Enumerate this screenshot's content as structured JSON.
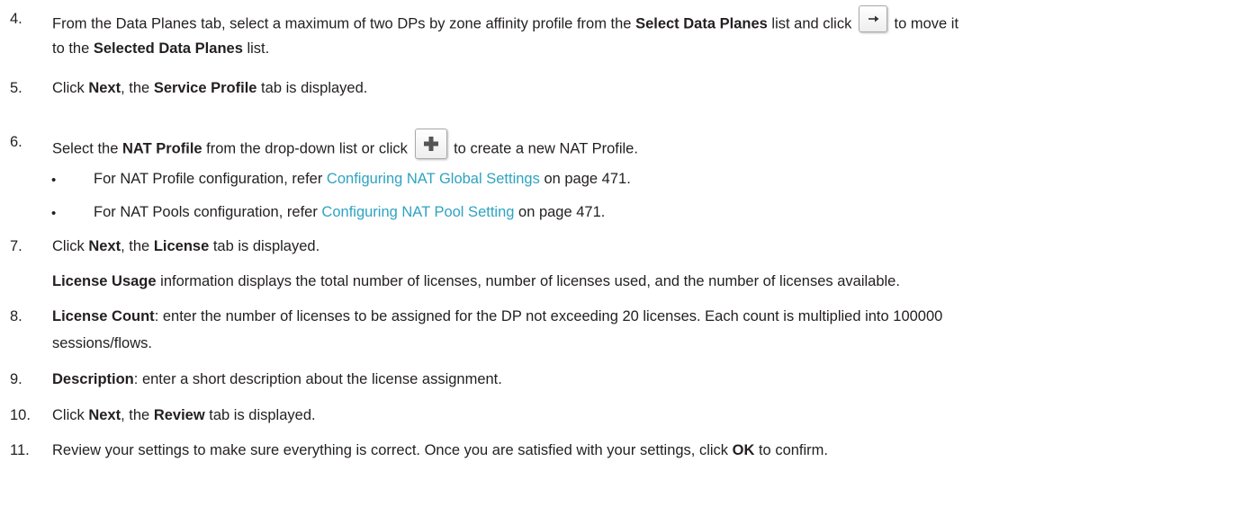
{
  "icons": {
    "arrow": "right-arrow-icon",
    "plus": "plus-icon"
  },
  "colors": {
    "link": "#2ea3c1",
    "text": "#231f20",
    "plus_icon": "#555555"
  },
  "s4": {
    "num": "4.",
    "a": "From the Data Planes tab, select a maximum of two DPs by zone affinity profile from the ",
    "b1": "Select Data Planes",
    "c": " list and click ",
    "d": " to move it",
    "e": "to the ",
    "b2": "Selected Data Planes",
    "f": " list."
  },
  "s5": {
    "num": "5.",
    "a": "Click ",
    "b1": "Next",
    "c": ", the ",
    "b2": "Service Profile",
    "d": " tab is displayed."
  },
  "s6": {
    "num": "6.",
    "a": "Select the ",
    "b1": "NAT Profile",
    "c": " from the drop-down list or click ",
    "d": " to create a new NAT Profile.",
    "bullets": [
      {
        "mark": "•",
        "a": "For NAT Profile configuration, refer ",
        "link": "Configuring NAT Global Settings",
        "b": " on page 471."
      },
      {
        "mark": "•",
        "a": "For NAT Pools configuration, refer ",
        "link": "Configuring NAT Pool Setting",
        "b": " on page 471."
      }
    ]
  },
  "s7": {
    "num": "7.",
    "a": "Click ",
    "b1": "Next",
    "c": ", the ",
    "b2": "License",
    "d": " tab is displayed.",
    "note_b": "License Usage",
    "note": " information displays the total number of licenses, number of licenses used, and the number of licenses available."
  },
  "s8": {
    "num": "8.",
    "b1": "License Count",
    "a": ": enter the number of licenses to be assigned for the DP not exceeding 20 licenses. Each count is multiplied into 100000",
    "l2": "sessions/flows."
  },
  "s9": {
    "num": "9.",
    "b1": "Description",
    "a": ": enter a short description about the license assignment."
  },
  "s10": {
    "num": "10.",
    "a": "Click ",
    "b1": "Next",
    "c": ", the ",
    "b2": "Review",
    "d": " tab is displayed."
  },
  "s11": {
    "num": "11.",
    "a": "Review your settings to make sure everything is correct. Once you are satisfied with your settings, click ",
    "b1": "OK",
    "c": " to confirm."
  }
}
